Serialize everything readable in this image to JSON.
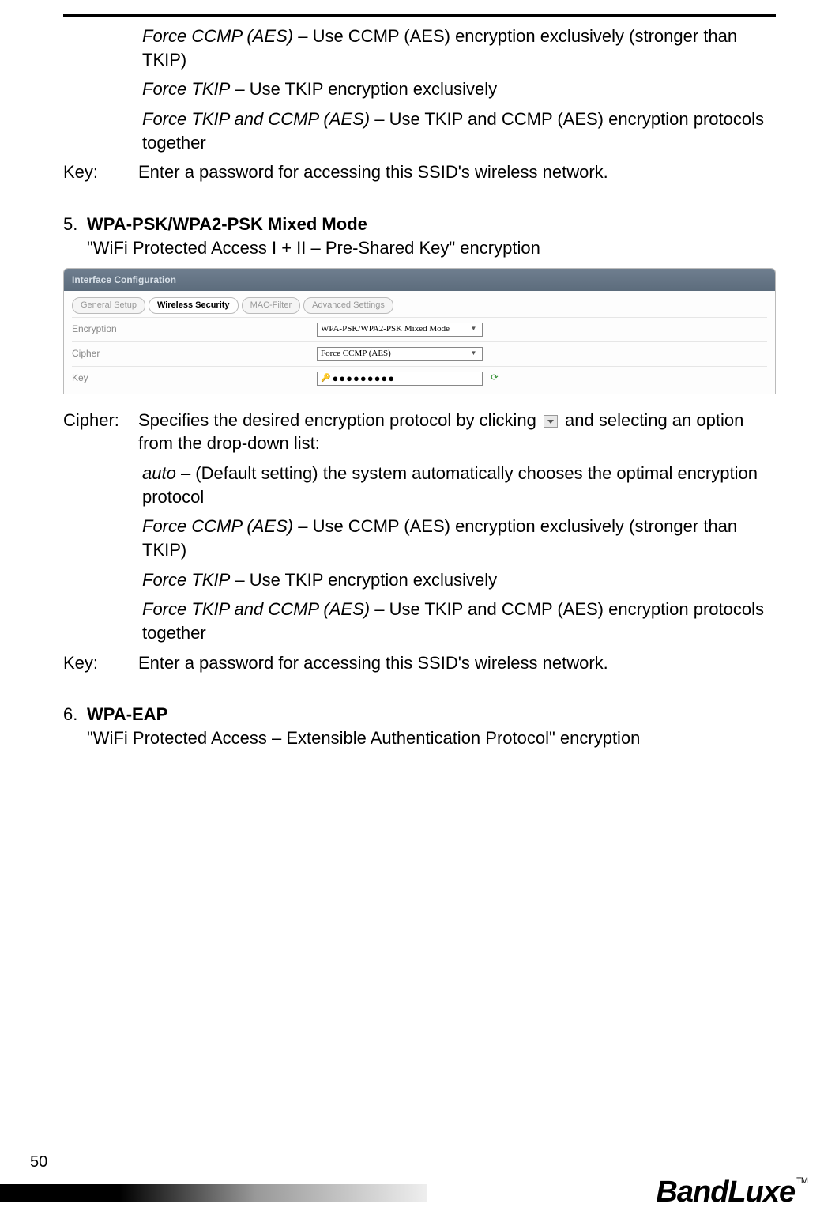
{
  "top_options": {
    "force_ccmp": {
      "label": "Force CCMP (AES)",
      "sep": " – ",
      "desc": "Use CCMP (AES) encryption exclusively (stronger than TKIP)"
    },
    "force_tkip": {
      "label": "Force TKIP",
      "sep": " – ",
      "desc": "Use TKIP encryption exclusively"
    },
    "force_both": {
      "label": "Force TKIP and CCMP (AES)",
      "sep": " – ",
      "desc": "Use TKIP and CCMP (AES) encryption protocols together"
    }
  },
  "key_row": {
    "label": "Key:",
    "desc": "Enter a password for accessing this SSID's wireless network."
  },
  "section5": {
    "num": "5.",
    "title": "WPA-PSK/WPA2-PSK Mixed Mode",
    "desc": "\"WiFi Protected Access I + II – Pre-Shared Key\" encryption"
  },
  "ui_panel": {
    "header": "Interface Configuration",
    "tabs": {
      "t1": "General Setup",
      "t2": "Wireless Security",
      "t3": "MAC-Filter",
      "t4": "Advanced Settings"
    },
    "rows": {
      "encryption": {
        "label": "Encryption",
        "value": "WPA-PSK/WPA2-PSK Mixed Mode"
      },
      "cipher": {
        "label": "Cipher",
        "value": "Force CCMP (AES)"
      },
      "key": {
        "label": "Key",
        "dots": "●●●●●●●●●"
      }
    }
  },
  "cipher_row": {
    "label": "Cipher:",
    "desc_a": "Specifies the desired encryption protocol by clicking ",
    "desc_b": " and selecting an option from the drop-down list:"
  },
  "cipher_options": {
    "auto": {
      "label": "auto",
      "sep": " – ",
      "desc": "(Default setting) the system automatically chooses the optimal encryption protocol"
    },
    "force_ccmp": {
      "label": "Force CCMP (AES)",
      "sep": " – ",
      "desc": "Use CCMP (AES) encryption exclusively (stronger than TKIP)"
    },
    "force_tkip": {
      "label": "Force TKIP",
      "sep": " – ",
      "desc": "Use TKIP encryption exclusively"
    },
    "force_both": {
      "label": "Force TKIP and CCMP (AES)",
      "sep": " – ",
      "desc": "Use TKIP and CCMP (AES) encryption protocols together"
    }
  },
  "section6": {
    "num": "6.",
    "title": "WPA-EAP",
    "desc": "\"WiFi Protected Access – Extensible Authentication Protocol\" encryption"
  },
  "page_number": "50",
  "logo": {
    "text": "BandLuxe",
    "tm": "TM"
  }
}
